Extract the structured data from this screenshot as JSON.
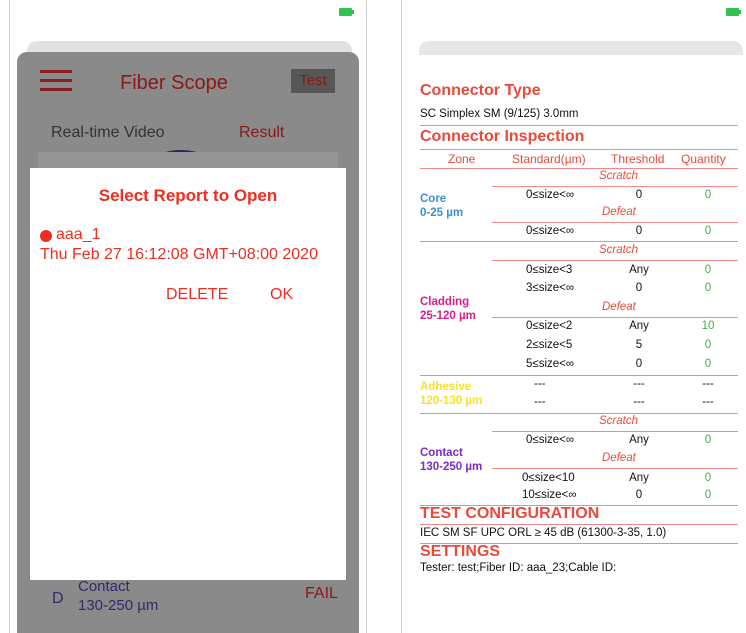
{
  "left": {
    "app_title": "Fiber Scope",
    "test_button": "Test",
    "tab_video": "Real-time Video",
    "tab_result": "Result",
    "dialog": {
      "title": "Select Report to Open",
      "report_name": "aaa_1",
      "report_date": "Thu Feb 27 16:12:08 GMT+08:00 2020",
      "delete_label": "DELETE",
      "ok_label": "OK"
    },
    "bg_row": {
      "zone_letter": "D",
      "zone_name": "Contact",
      "zone_range": "130-250 µm",
      "status": "FAIL"
    }
  },
  "right": {
    "connector_type_title": "Connector Type",
    "connector_type_value": "SC Simplex SM (9/125) 3.0mm",
    "inspection_title": "Connector Inspection",
    "headers": {
      "zone": "Zone",
      "standard": "Standard(µm)",
      "threshold": "Threshold",
      "quantity": "Quantity"
    },
    "scratch": "Scratch",
    "defeat": "Defeat",
    "zones": {
      "core": {
        "name": "Core",
        "range": "0-25 µm"
      },
      "cladding": {
        "name": "Cladding",
        "range": "25-120 µm"
      },
      "adhesive": {
        "name": "Adhesive",
        "range": "120-130 µm"
      },
      "contact": {
        "name": "Contact",
        "range": "130-250 µm"
      }
    },
    "rows": {
      "core_scratch": [
        "0≤size<∞",
        "0",
        "0"
      ],
      "core_defeat": [
        "0≤size<∞",
        "0",
        "0"
      ],
      "clad_s1": [
        "0≤size<3",
        "Any",
        "0"
      ],
      "clad_s2": [
        "3≤size<∞",
        "0",
        "0"
      ],
      "clad_d1": [
        "0≤size<2",
        "Any",
        "10"
      ],
      "clad_d2": [
        "2≤size<5",
        "5",
        "0"
      ],
      "clad_d3": [
        "5≤size<∞",
        "0",
        "0"
      ],
      "adh_1": [
        "---",
        "---",
        "---"
      ],
      "adh_2": [
        "---",
        "---",
        "---"
      ],
      "cont_s1": [
        "0≤size<∞",
        "Any",
        "0"
      ],
      "cont_d1": [
        "0≤size<10",
        "Any",
        "0"
      ],
      "cont_d2": [
        "10≤size<∞",
        "0",
        "0"
      ]
    },
    "test_config_title": "TEST CONFIGURATION",
    "test_config_value": "IEC SM SF UPC ORL ≥ 45 dB (61300-3-35, 1.0)",
    "settings_title": "SETTINGS",
    "settings_value": "Tester: test;Fiber ID: aaa_23;Cable ID:"
  },
  "colors": {
    "accent": "#ee2e22",
    "core": "#3d8fd6",
    "cladding": "#d6208f",
    "adhesive": "#f5e22a",
    "contact": "#7a2bc8",
    "pass": "#3fae48"
  }
}
